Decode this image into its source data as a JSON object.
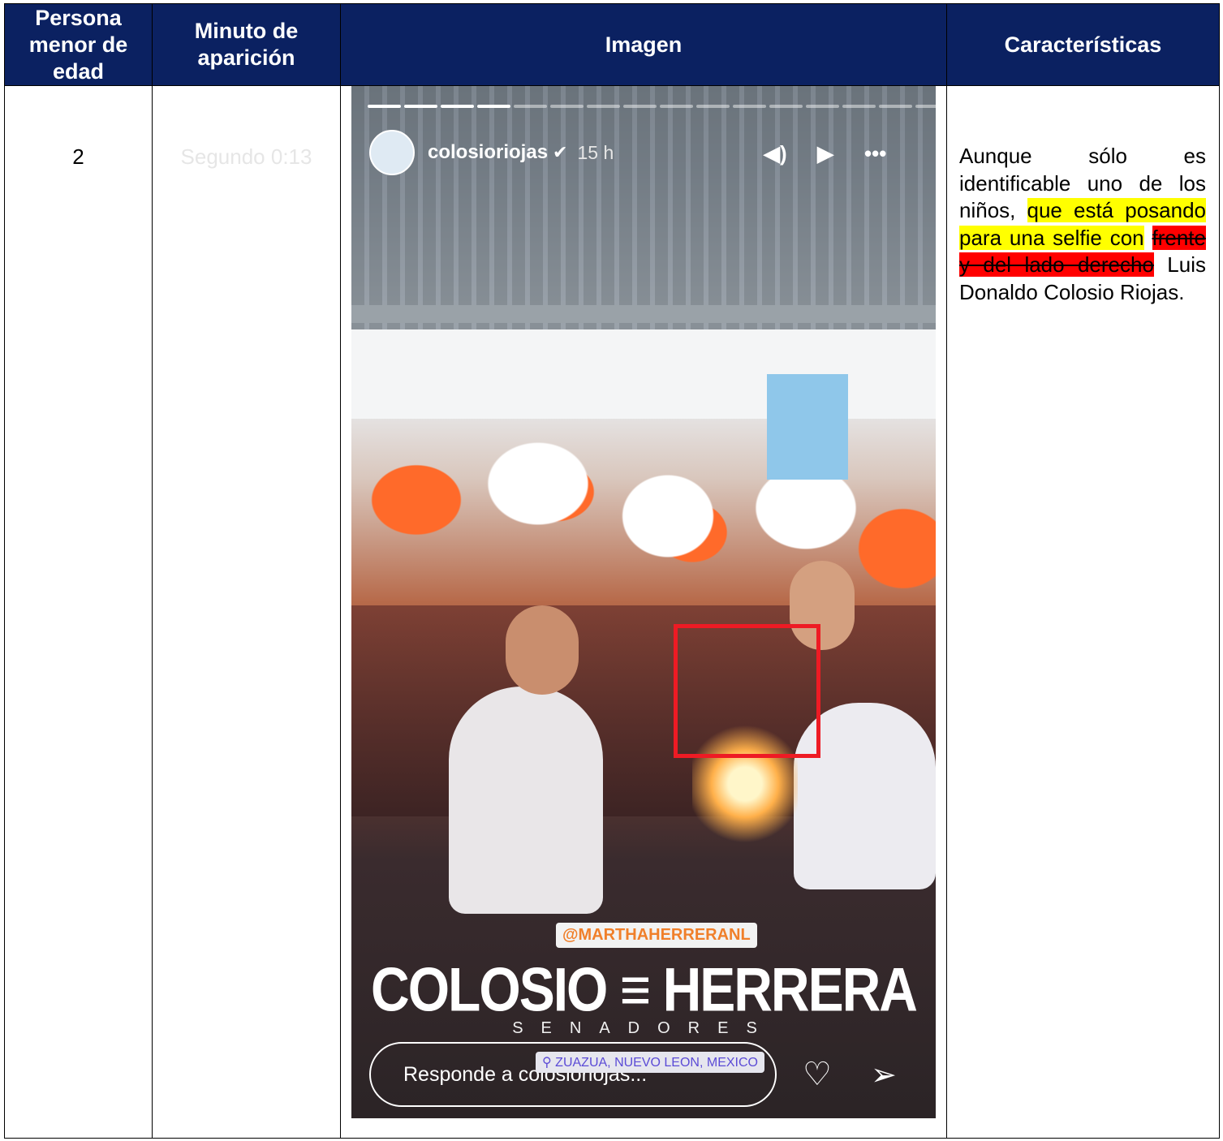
{
  "table": {
    "headers": [
      "Persona menor de edad",
      "Minuto de aparición",
      "Imagen",
      "Características"
    ],
    "row": {
      "number": "2",
      "time": "Segundo 0:13",
      "description": {
        "part1": "Aunque sólo es identificable uno de los niños, ",
        "highlight_yellow": "que está posando para una selfie con",
        "part2": " ",
        "highlight_red_struck": "frente y del lado derecho",
        "part3": " Luis Donaldo Colosio Riojas."
      }
    }
  },
  "story": {
    "username": "colosioriojas",
    "elapsed": "15 h",
    "progress_total": 16,
    "progress_done": 4,
    "tag_overlay": "@MARTHAHERRERANL",
    "title_overlay": "COLOSIO ≡ HERRERA",
    "subtitle_overlay": "SENADORES",
    "location": "ZUAZUA, NUEVO LEON, MEXICO",
    "reply_placeholder": "Responde a colosioriojas...",
    "icons": [
      "volume-icon",
      "play-icon",
      "more-icon",
      "heart-icon",
      "send-icon",
      "verified-icon",
      "location-pin-icon"
    ],
    "highlight_color": "#ee1b24"
  }
}
